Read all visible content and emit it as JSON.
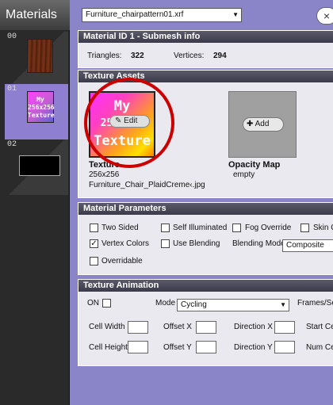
{
  "sidebar": {
    "title": "Materials",
    "slots": [
      {
        "num": "00",
        "thumb": "wood-texture-thumbnail"
      },
      {
        "num": "01",
        "thumb_text": "My 256x256 Texture"
      },
      {
        "num": "02",
        "thumb": "black-thumbnail"
      }
    ]
  },
  "header": {
    "file_value": "Furniture_chairpattern01.xrf",
    "close_label": "×"
  },
  "info": {
    "title": "Material ID 1 - Submesh info",
    "triangles_label": "Triangles:",
    "triangles_value": "322",
    "vertices_label": "Vertices:",
    "vertices_value": "294"
  },
  "texture_assets": {
    "title": "Texture Assets",
    "texture": {
      "thumb_line1": "My",
      "thumb_line2": "256x256",
      "thumb_line3": "Texture",
      "edit_label": "Edit",
      "name": "Texture",
      "size": "256x256",
      "file": "Furniture_Chair_PlaidCreme‹.jpg"
    },
    "opacity": {
      "add_label": "Add",
      "name": "Opacity Map",
      "status": "empty"
    }
  },
  "params": {
    "title": "Material Parameters",
    "two_sided": "Two Sided",
    "self_illum": "Self Illuminated",
    "fog": "Fog Override",
    "skin": "Skin C",
    "vertex_colors": "Vertex Colors",
    "use_blending": "Use Blending",
    "blend_mode_label": "Blending Mode",
    "blend_mode_value": "Composite",
    "overridable": "Overridable",
    "vertex_colors_checked": true
  },
  "animation": {
    "title": "Texture Animation",
    "on_label": "ON",
    "mode_label": "Mode",
    "mode_value": "Cycling",
    "frames_label": "Frames/Se",
    "cell_width": "Cell Width",
    "offset_x": "Offset X",
    "direction_x": "Direction X",
    "start": "Start Ce",
    "cell_height": "Cell Height",
    "offset_y": "Offset Y",
    "direction_y": "Direction Y",
    "num_cells": "Num Cel"
  }
}
